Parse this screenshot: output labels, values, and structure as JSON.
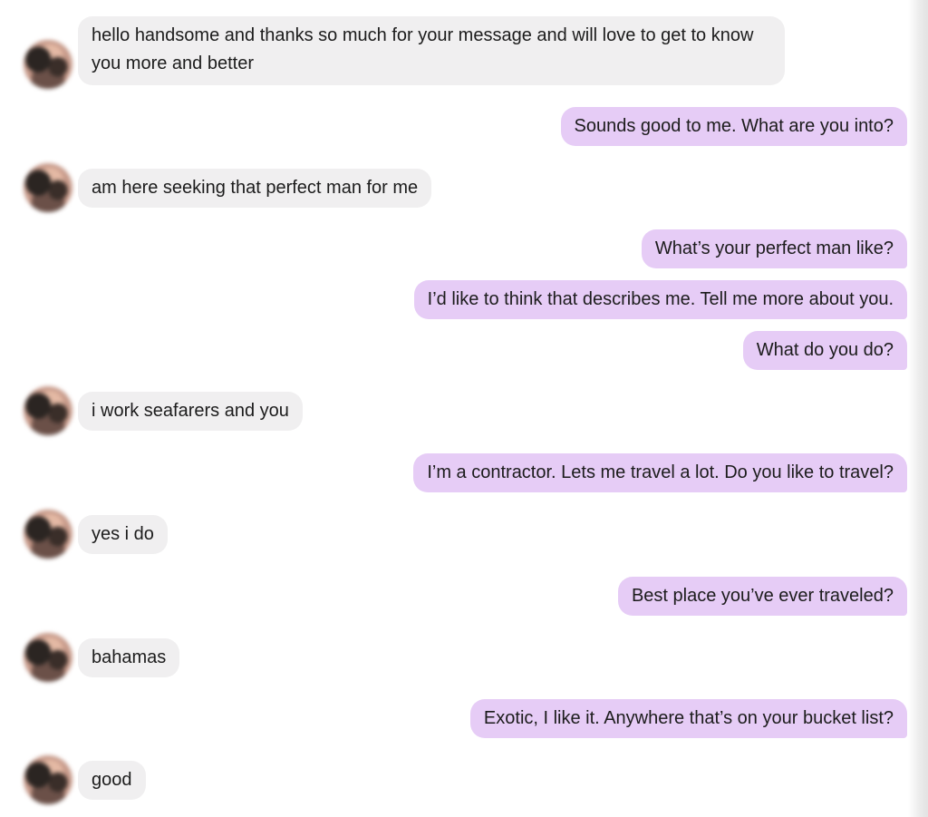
{
  "conversation": {
    "messages": [
      {
        "from": "them",
        "text": "hello handsome and thanks so much for your message and will love to get to know you more and better"
      },
      {
        "from": "me",
        "text": "Sounds good to me. What are you into?"
      },
      {
        "from": "them",
        "text": "am here seeking that perfect man for me"
      },
      {
        "from": "me",
        "text": "What’s your perfect man like?"
      },
      {
        "from": "me",
        "text": "I’d like to think that describes me. Tell me more about you."
      },
      {
        "from": "me",
        "text": "What do you do?"
      },
      {
        "from": "them",
        "text": "i work seafarers and you"
      },
      {
        "from": "me",
        "text": "I’m a contractor. Lets me travel a lot. Do you like to travel?"
      },
      {
        "from": "them",
        "text": "yes i do"
      },
      {
        "from": "me",
        "text": "Best place you’ve ever traveled?"
      },
      {
        "from": "them",
        "text": "bahamas"
      },
      {
        "from": "me",
        "text": "Exotic, I like it. Anywhere that’s on your bucket list?"
      },
      {
        "from": "them",
        "text": "good"
      }
    ]
  },
  "colors": {
    "incoming_bubble": "#f0eff0",
    "outgoing_bubble": "#e6ccf6",
    "text": "#1c1c1c"
  },
  "icons": {
    "avatar": "contact-avatar-photo-blurred"
  }
}
